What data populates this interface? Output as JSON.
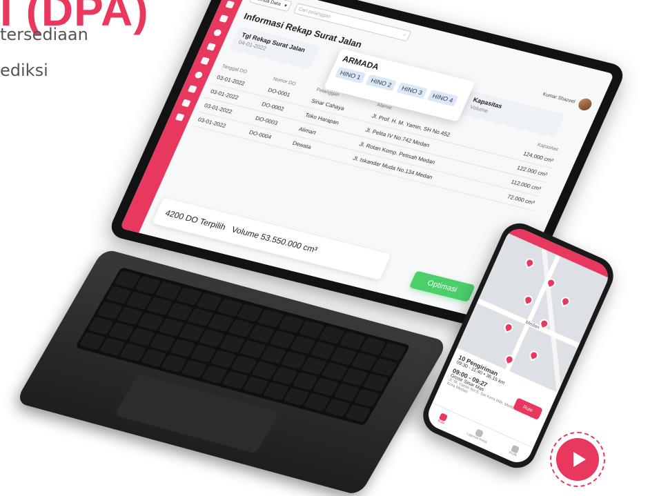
{
  "hero": {
    "title": "I (DPA)",
    "subtitle_line1": "tersediaan",
    "subtitle_line2": "ediksi"
  },
  "laptop_app": {
    "filter_select": "Semua Data",
    "search_placeholder": "Cari pelanggan",
    "page_title": "Informasi Rekap Surat Jalan",
    "user_name": "Kumar Shazeel",
    "tgl_card": {
      "label": "Tgl Rekap Surat Jalan",
      "value": "04-01-2022"
    },
    "kapasitas_card": {
      "label": "Kapasitas",
      "value": "Volume"
    },
    "armada": {
      "title": "ARMADA",
      "chips": [
        "HINO 1",
        "HINO 2",
        "HINO 3",
        "HINO 4"
      ]
    },
    "table": {
      "headers": [
        "Tanggal DO",
        "Nomor DO",
        "Pelanggan",
        "Alamat",
        "Kapasitas"
      ],
      "rows": [
        [
          "03-01-2022",
          "DO-0001",
          "Sinar Cahaya",
          "Jl. Prof. H. M. Yamin, SH No.452",
          "124.000 cm³"
        ],
        [
          "03-01-2022",
          "DO-0002",
          "Toko Harapan",
          "Jl. Pelita IV No.742 Medan",
          "122.000 cm³"
        ],
        [
          "03-01-2022",
          "DO-0003",
          "Alimart",
          "Jl. Rotan Komp. Petisah Medan",
          "112.000 cm³"
        ],
        [
          "03-01-2022",
          "DO-0004",
          "Dewata",
          "Jl. Iskandar Muda No.134 Medan",
          "72.000 cm³"
        ]
      ]
    },
    "summary": {
      "selected": "4200 DO Terpilih",
      "volume": "Volume 53.550.000 cm³"
    },
    "optimize_label": "Optimasi"
  },
  "phone_app": {
    "shipment_title": "10 Pengiriman",
    "time_range": "09:30 - 11:40",
    "distance": "36,15 km",
    "stop_time": "09:00 - 09:27",
    "stop_name": "Grosir Sinar Mas",
    "stop_address": "Jl. M. Yamin No.5, Sei Kera Hilir, Medan Perjuangan, Kota Medan",
    "rute_label": "Rute",
    "nav": [
      "Rute",
      "Laporan Kerja",
      "Profil"
    ],
    "map_label": "Medan"
  },
  "colors": {
    "accent": "#e8385e",
    "success": "#4cce6b"
  },
  "icons": [
    "play-icon",
    "search-icon",
    "chevron-down-icon",
    "map-pin-icon"
  ]
}
